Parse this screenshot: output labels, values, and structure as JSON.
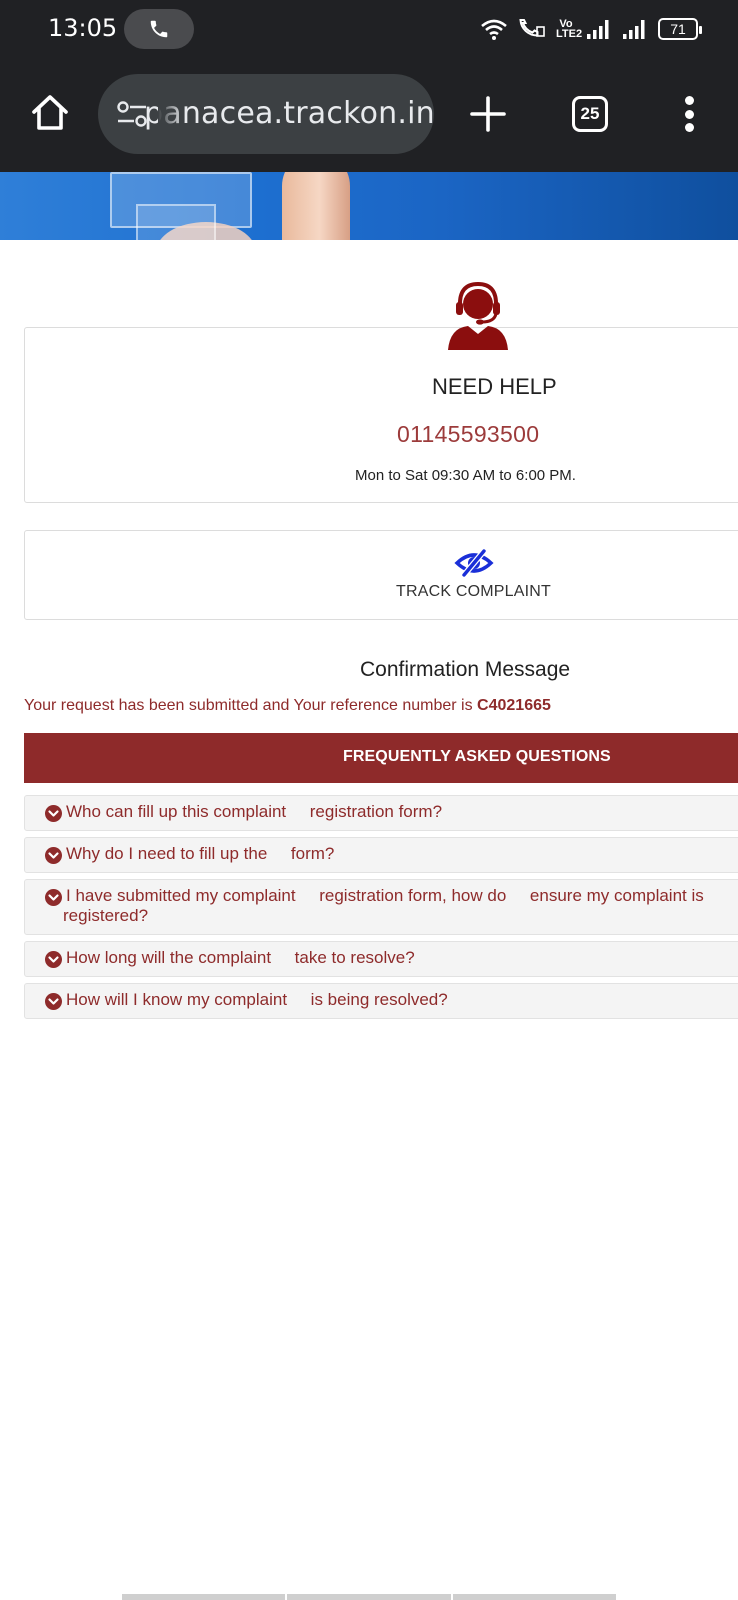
{
  "status_bar": {
    "time": "13:05",
    "battery": "71",
    "volte": "Vo LTE2"
  },
  "browser": {
    "url": "panacea.trackon.in",
    "tab_count": "25"
  },
  "help": {
    "title": "NEED HELP",
    "phone": "01145593500",
    "hours": "Mon to Sat 09:30 AM to 6:00 PM."
  },
  "track": {
    "label": "TRACK COMPLAINT"
  },
  "confirmation": {
    "title": "Confirmation Message",
    "message": "Your request has been submitted and Your reference number is ",
    "reference": "C4021665"
  },
  "faq": {
    "header": "FREQUENTLY ASKED QUESTIONS",
    "items": [
      {
        "line1": "Who can fill up this complaint     registration form?",
        "line2": ""
      },
      {
        "line1": "Why do I need to fill up the     form?",
        "line2": ""
      },
      {
        "line1": "I have submitted my complaint     registration form, how do     ensure my complaint is",
        "line2": "registered?"
      },
      {
        "line1": "How long will the complaint     take to resolve?",
        "line2": ""
      },
      {
        "line1": "How will I know my complaint     is being resolved?",
        "line2": ""
      }
    ]
  },
  "colors": {
    "brand_red": "#8e2a2a",
    "toolbar": "#202124"
  }
}
